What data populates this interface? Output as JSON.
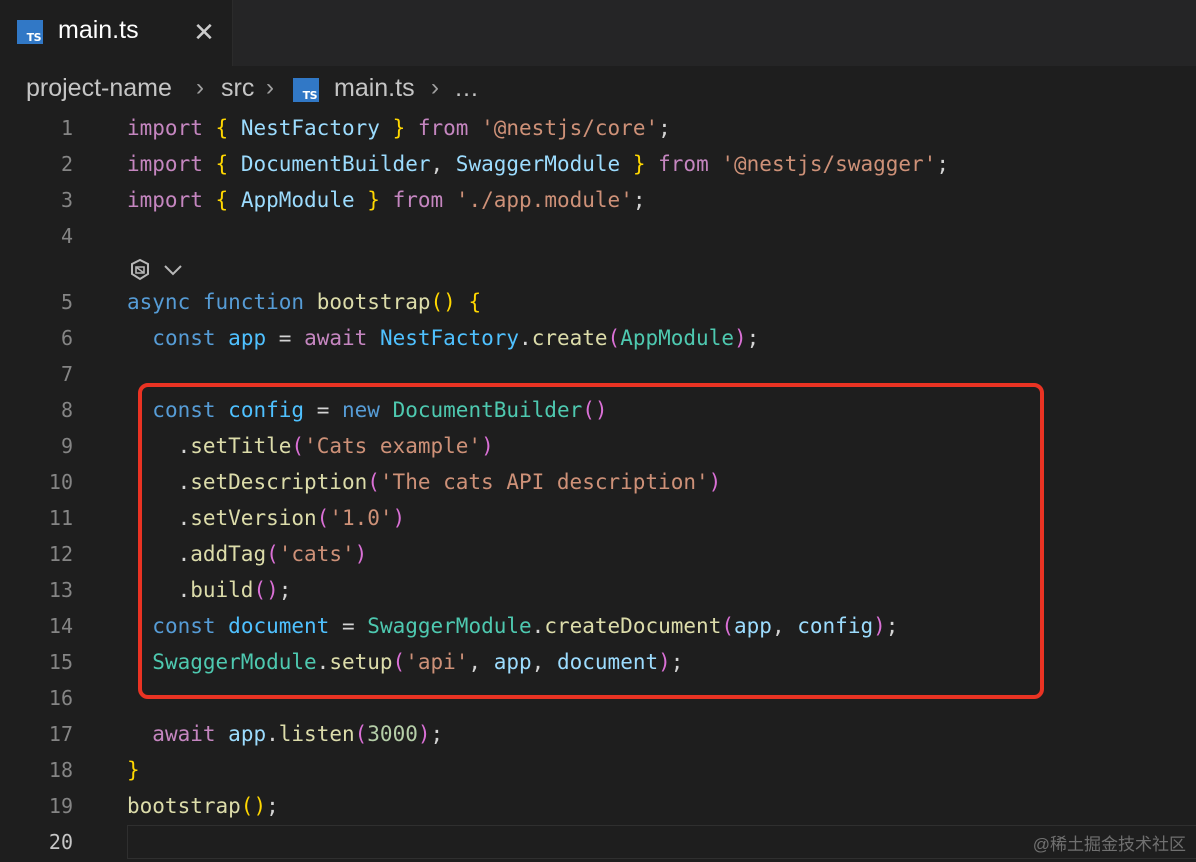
{
  "tab": {
    "icon_text": "TS",
    "title": "main.ts",
    "close_glyph": "✕"
  },
  "breadcrumb": {
    "items": [
      "project-name",
      "src",
      "main.ts",
      "…"
    ],
    "separator": "›",
    "icon_text": "TS"
  },
  "lines": [
    "1",
    "2",
    "3",
    "4",
    "5",
    "6",
    "7",
    "8",
    "9",
    "10",
    "11",
    "12",
    "13",
    "14",
    "15",
    "16",
    "17",
    "18",
    "19",
    "20"
  ],
  "code": {
    "l1": [
      "import",
      "{",
      "NestFactory",
      "}",
      "from",
      "'@nestjs/core'",
      ";"
    ],
    "l2": [
      "import",
      "{",
      "DocumentBuilder",
      ",",
      "SwaggerModule",
      "}",
      "from",
      "'@nestjs/swagger'",
      ";"
    ],
    "l3": [
      "import",
      "{",
      "AppModule",
      "}",
      "from",
      "'./app.module'",
      ";"
    ],
    "l5": [
      "async",
      "function",
      "bootstrap",
      "(",
      ")",
      "{"
    ],
    "l6": [
      "const",
      "app",
      "=",
      "await",
      "NestFactory",
      ".",
      "create",
      "(",
      "AppModule",
      ")",
      ";"
    ],
    "l8": [
      "const",
      "config",
      "=",
      "new",
      "DocumentBuilder",
      "(",
      ")"
    ],
    "l9": [
      ".",
      "setTitle",
      "(",
      "'Cats example'",
      ")"
    ],
    "l10": [
      ".",
      "setDescription",
      "(",
      "'The cats API description'",
      ")"
    ],
    "l11": [
      ".",
      "setVersion",
      "(",
      "'1.0'",
      ")"
    ],
    "l12": [
      ".",
      "addTag",
      "(",
      "'cats'",
      ")"
    ],
    "l13": [
      ".",
      "build",
      "(",
      ")",
      ";"
    ],
    "l14": [
      "const",
      "document",
      "=",
      "SwaggerModule",
      ".",
      "createDocument",
      "(",
      "app",
      ",",
      "config",
      ")",
      ";"
    ],
    "l15": [
      "SwaggerModule",
      ".",
      "setup",
      "(",
      "'api'",
      ",",
      "app",
      ",",
      "document",
      ")",
      ";"
    ],
    "l17": [
      "await",
      "app",
      ".",
      "listen",
      "(",
      "3000",
      ")",
      ";"
    ],
    "l18": [
      "}"
    ],
    "l19": [
      "bootstrap",
      "(",
      ")",
      ";"
    ]
  },
  "codelens": {
    "icon": "ai-codelens-icon",
    "chevron": "chevron-down-icon"
  },
  "watermark": "@稀土掘金技术社区",
  "colors": {
    "highlight_box": "#ea3323",
    "ts_icon": "#3178c6",
    "background": "#1e1e1e"
  }
}
